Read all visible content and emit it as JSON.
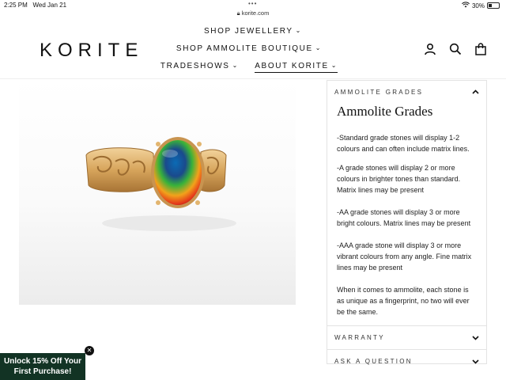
{
  "status_bar": {
    "time": "2:25 PM",
    "date": "Wed Jan 21",
    "url": "korite.com",
    "battery": "30%"
  },
  "header": {
    "logo": "KORITE",
    "nav": [
      {
        "label": "SHOP JEWELLERY"
      },
      {
        "label": "SHOP AMMOLITE BOUTIQUE"
      },
      {
        "label": "TRADESHOWS"
      },
      {
        "label": "ABOUT KORITE"
      }
    ]
  },
  "accordion": {
    "open_header": "AMMOLITE GRADES",
    "title": "Ammolite Grades",
    "paragraphs": [
      "-Standard grade stones will display 1-2 colours and can often include matrix lines.",
      "-A grade stones will display 2 or more colours in brighter tones than standard. Matrix lines may be present",
      "-AA grade stones will display 3 or more bright colours. Matrix lines may be present",
      "-AAA grade stone will display 3 or more vibrant colours from any angle. Fine matrix lines may be present",
      "When it comes to ammolite, each stone is as unique as a fingerprint, no two will ever be the same."
    ],
    "warranty": "WARRANTY",
    "ask": "ASK A QUESTION"
  },
  "promo": {
    "line1": "Unlock 15% Off Your",
    "line2": "First Purchase!"
  },
  "icons": {
    "account": "person-icon",
    "search": "search-icon",
    "cart": "bag-icon",
    "close": "close-icon"
  }
}
